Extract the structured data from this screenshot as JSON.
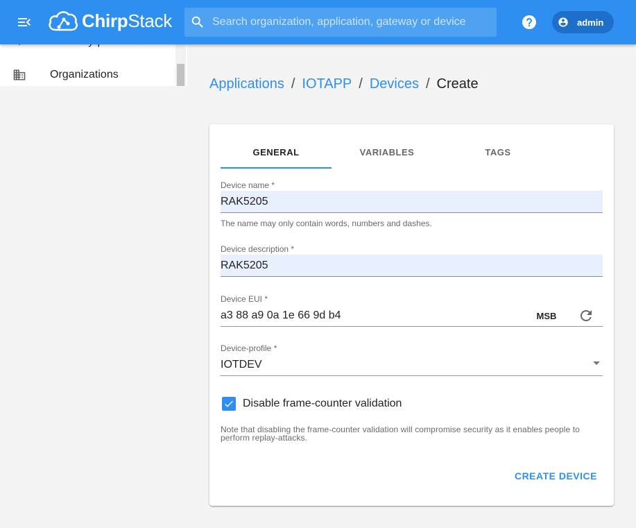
{
  "header": {
    "brand_prefix": "Chirp",
    "brand_suffix": "Stack",
    "search_placeholder": "Search organization, application, gateway or device",
    "user_name": "admin",
    "colors": {
      "primary": "#2e8ff0",
      "chip": "#1e6fc9"
    }
  },
  "sidebar": {
    "items": [
      {
        "label": "Gateway-profiles",
        "icon": "gateway-profiles-icon"
      },
      {
        "label": "Organizations",
        "icon": "organizations-icon"
      }
    ]
  },
  "breadcrumb": {
    "items": [
      "Applications",
      "IOTAPP",
      "Devices"
    ],
    "current": "Create",
    "separator": "/"
  },
  "tabs": [
    "GENERAL",
    "VARIABLES",
    "TAGS"
  ],
  "form": {
    "device_name": {
      "label": "Device name *",
      "value": "RAK5205",
      "helper": "The name may only contain words, numbers and dashes."
    },
    "device_description": {
      "label": "Device description *",
      "value": "RAK5205"
    },
    "device_eui": {
      "label": "Device EUI *",
      "value": "a3 88 a9 0a 1e 66 9d b4",
      "byte_order": "MSB"
    },
    "device_profile": {
      "label": "Device-profile *",
      "value": "IOTDEV"
    },
    "disable_fcnt": {
      "label": "Disable frame-counter validation",
      "checked": true
    },
    "note": "Note that disabling the frame-counter validation will compromise security as it enables people to perform replay-attacks.",
    "submit_label": "CREATE DEVICE"
  }
}
